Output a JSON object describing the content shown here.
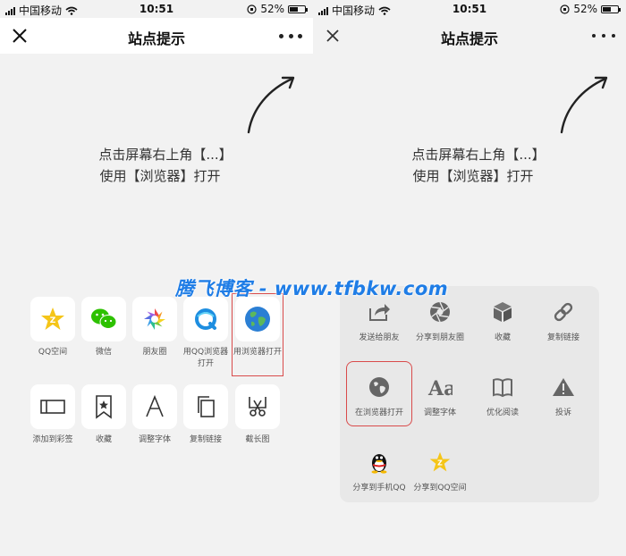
{
  "status": {
    "carrier": "中国移动",
    "time": "10:51",
    "battery": "52%",
    "battery_level": 0.52
  },
  "left": {
    "nav": {
      "title": "站点提示"
    },
    "tip": {
      "line1": "点击屏幕右上角【...】",
      "line2": "使用【浏览器】打开"
    },
    "grid": [
      {
        "label": "QQ空间",
        "icon": "qzone-icon"
      },
      {
        "label": "微信",
        "icon": "wechat-icon"
      },
      {
        "label": "朋友圈",
        "icon": "moments-icon"
      },
      {
        "label": "用QQ浏览器打开",
        "icon": "qq-browser-icon"
      },
      {
        "label": "用浏览器打开",
        "icon": "browser-globe-icon"
      },
      {
        "label": "添加到彩签",
        "icon": "color-tab-icon"
      },
      {
        "label": "收藏",
        "icon": "bookmark-star-icon"
      },
      {
        "label": "调整字体",
        "icon": "font-a-icon"
      },
      {
        "label": "复制链接",
        "icon": "copy-icon"
      },
      {
        "label": "截长图",
        "icon": "scissors-icon"
      }
    ]
  },
  "right": {
    "nav": {
      "title": "站点提示"
    },
    "tip": {
      "line1": "点击屏幕右上角【...】",
      "line2": "使用【浏览器】打开"
    },
    "menu": [
      {
        "label": "发送给朋友",
        "icon": "share-arrow-icon"
      },
      {
        "label": "分享到朋友圈",
        "icon": "aperture-icon"
      },
      {
        "label": "收藏",
        "icon": "cube-icon"
      },
      {
        "label": "复制链接",
        "icon": "link-icon"
      },
      {
        "label": "在浏览器打开",
        "icon": "globe-icon"
      },
      {
        "label": "调整字体",
        "icon": "font-aa-icon"
      },
      {
        "label": "优化阅读",
        "icon": "book-icon"
      },
      {
        "label": "投诉",
        "icon": "warning-icon"
      },
      {
        "label": "分享到手机QQ",
        "icon": "qq-penguin-icon"
      },
      {
        "label": "分享到QQ空间",
        "icon": "qzone-star-icon"
      }
    ]
  },
  "watermark": "腾飞博客 - www.tfbkw.com",
  "colors": {
    "highlight": "#d94b4b",
    "watermark": "#1f7de6",
    "sheet_bg": "#e8e8e8",
    "page_bg": "#f2f2f2"
  }
}
